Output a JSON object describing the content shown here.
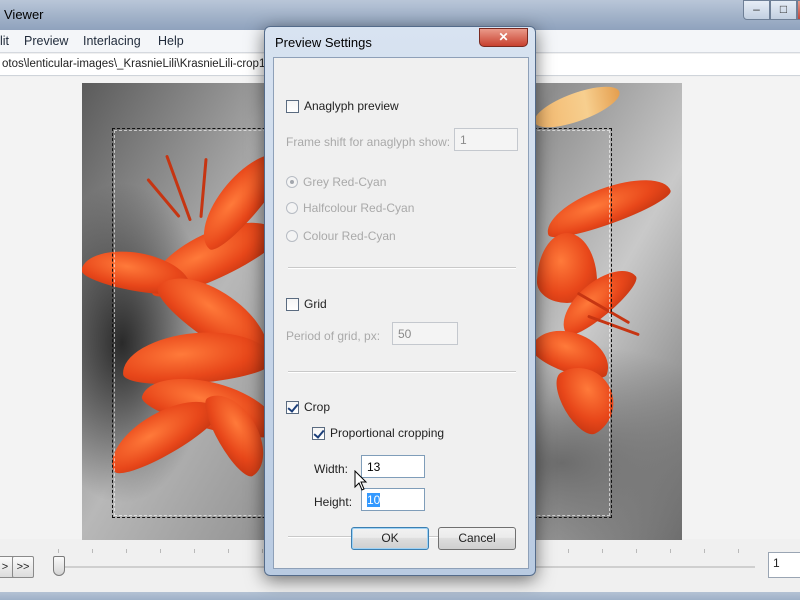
{
  "main_window": {
    "title": "Viewer",
    "controls": {
      "minimize": "–",
      "maximize": "□",
      "close": "✕"
    }
  },
  "menu": {
    "items": [
      "lit",
      "Preview",
      "Interlacing",
      "Help"
    ]
  },
  "path": "otos\\lenticular-images\\_KrasnieLili\\KrasnieLili-crop1",
  "navigation": {
    "prev_label": ">",
    "next_label": ">>",
    "frame_value": "1"
  },
  "dialog": {
    "title": "Preview Settings",
    "close_label": "✕",
    "anaglyph": {
      "label": "Anaglyph preview",
      "checked": false,
      "frame_shift_label": "Frame shift for anaglyph show:",
      "frame_shift_value": "1",
      "options": [
        {
          "label": "Grey Red-Cyan",
          "selected": true
        },
        {
          "label": "Halfcolour Red-Cyan",
          "selected": false
        },
        {
          "label": "Colour Red-Cyan",
          "selected": false
        }
      ]
    },
    "grid": {
      "label": "Grid",
      "checked": false,
      "period_label": "Period of grid, px:",
      "period_value": "50"
    },
    "crop": {
      "label": "Crop",
      "checked": true,
      "proportional_label": "Proportional cropping",
      "proportional_checked": true,
      "width_label": "Width:",
      "width_value": "13",
      "height_label": "Height:",
      "height_value": "10"
    },
    "ok_label": "OK",
    "cancel_label": "Cancel"
  },
  "icons": {
    "cursor": "arrow-pointer-icon"
  }
}
